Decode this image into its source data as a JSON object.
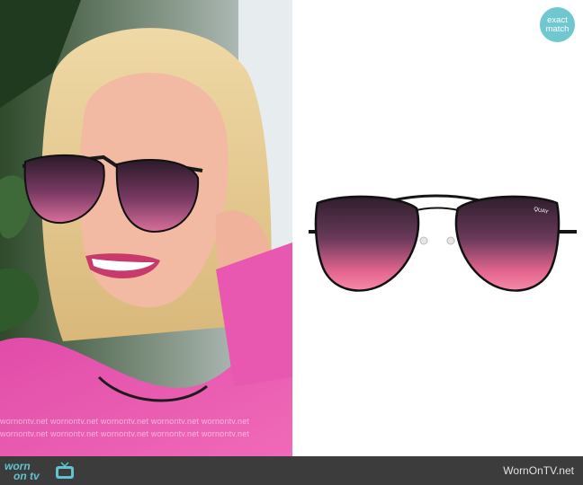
{
  "watermark": {
    "row1": "wornontv.net wornontv.net wornontv.net wornontv.net wornontv.net",
    "row2": "wornontv.net wornontv.net wornontv.net wornontv.net wornontv.net"
  },
  "badge": {
    "line1": "exact",
    "line2": "match"
  },
  "product": {
    "brand_mark": "QUAY"
  },
  "footer": {
    "logo_word1": "worn",
    "logo_word2": "on tv",
    "site": "WornOnTV.net"
  },
  "colors": {
    "accent": "#5fc4cf",
    "footer_bg": "#3c3c3c",
    "lens_top": "#3a2236",
    "lens_bottom": "#f27aa0"
  }
}
